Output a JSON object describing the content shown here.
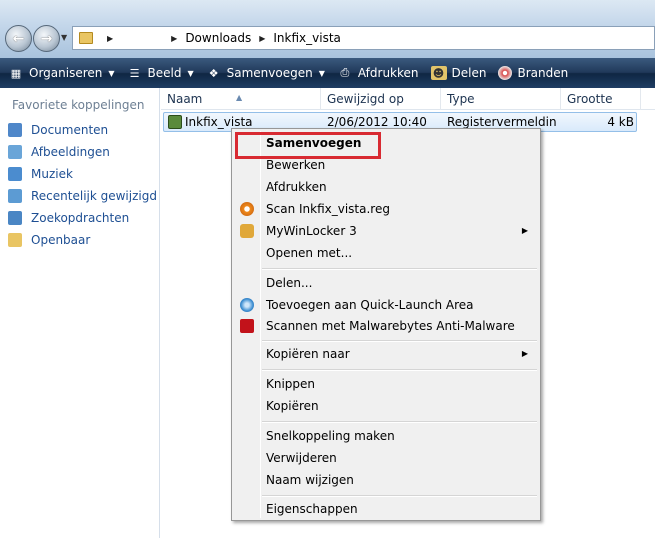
{
  "address": {
    "path": [
      "",
      "Downloads",
      "Inkfix_vista"
    ]
  },
  "commandbar": {
    "items": [
      {
        "label": "Organiseren",
        "icon": "organize-icon",
        "dropdown": true
      },
      {
        "label": "Beeld",
        "icon": "views-icon",
        "dropdown": true
      },
      {
        "label": "Samenvoegen",
        "icon": "merge-icon",
        "dropdown": true
      },
      {
        "label": "Afdrukken",
        "icon": "printer-icon",
        "dropdown": false
      },
      {
        "label": "Delen",
        "icon": "share-icon",
        "dropdown": false
      },
      {
        "label": "Branden",
        "icon": "burn-disc-icon",
        "dropdown": false
      }
    ]
  },
  "sidebar": {
    "title": "Favoriete koppelingen",
    "items": [
      {
        "label": "Documenten",
        "icon": "documents-icon",
        "color": "#4f87c9"
      },
      {
        "label": "Afbeeldingen",
        "icon": "pictures-icon",
        "color": "#6aa5d8"
      },
      {
        "label": "Muziek",
        "icon": "music-icon",
        "color": "#4b8ccf"
      },
      {
        "label": "Recentelijk gewijzigd",
        "icon": "recent-icon",
        "color": "#5c9bd3"
      },
      {
        "label": "Zoekopdrachten",
        "icon": "search-icon",
        "color": "#4a86c4"
      },
      {
        "label": "Openbaar",
        "icon": "public-folder-icon",
        "color": "#e9c563"
      }
    ]
  },
  "filelist": {
    "columns": [
      "Naam",
      "Gewijzigd op",
      "Type",
      "Grootte"
    ],
    "rows": [
      {
        "name": "Inkfix_vista",
        "modified": "2/06/2012 10:40",
        "type": "Registervermeldin...",
        "size": "4 kB"
      }
    ]
  },
  "contextmenu": {
    "groups": [
      [
        {
          "label": "Samenvoegen",
          "bold": true
        },
        {
          "label": "Bewerken"
        },
        {
          "label": "Afdrukken"
        },
        {
          "label": "Scan Inkfix_vista.reg",
          "icon": "antivirus-scan-icon",
          "icon_color": "#f08a1c"
        },
        {
          "label": "MyWinLocker 3",
          "icon": "lock-icon",
          "icon_color": "#e0a83a",
          "submenu": true
        },
        {
          "label": "Openen met..."
        }
      ],
      [
        {
          "label": "Delen..."
        },
        {
          "label": "Toevoegen aan Quick-Launch Area",
          "icon": "quick-launch-icon",
          "icon_color": "#3f8fd2"
        },
        {
          "label": "Scannen met Malwarebytes Anti-Malware",
          "icon": "malwarebytes-icon",
          "icon_color": "#c2121a"
        }
      ],
      [
        {
          "label": "Kopiëren naar",
          "submenu": true
        }
      ],
      [
        {
          "label": "Knippen"
        },
        {
          "label": "Kopiëren"
        }
      ],
      [
        {
          "label": "Snelkoppeling maken"
        },
        {
          "label": "Verwijderen"
        },
        {
          "label": "Naam wijzigen"
        }
      ],
      [
        {
          "label": "Eigenschappen"
        }
      ]
    ]
  },
  "colors": {
    "highlight_box": "#d82a32",
    "link_blue": "#1e4f93",
    "commandbar": "#1e3d63"
  }
}
